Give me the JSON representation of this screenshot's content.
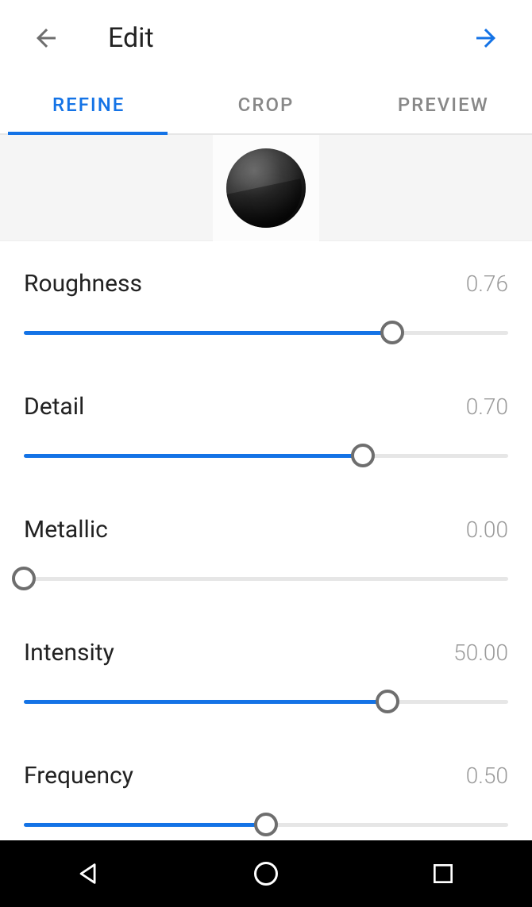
{
  "header": {
    "title": "Edit",
    "back_icon": "arrow-left",
    "forward_icon": "arrow-right"
  },
  "tabs": [
    {
      "label": "REFINE",
      "active": true
    },
    {
      "label": "CROP",
      "active": false
    },
    {
      "label": "PREVIEW",
      "active": false
    }
  ],
  "preview": {
    "material_icon": "sphere-preview"
  },
  "sliders": [
    {
      "name": "roughness",
      "label": "Roughness",
      "value_text": "0.76",
      "fraction": 0.76
    },
    {
      "name": "detail",
      "label": "Detail",
      "value_text": "0.70",
      "fraction": 0.7
    },
    {
      "name": "metallic",
      "label": "Metallic",
      "value_text": "0.00",
      "fraction": 0.0
    },
    {
      "name": "intensity",
      "label": "Intensity",
      "value_text": "50.00",
      "fraction": 0.75
    },
    {
      "name": "frequency",
      "label": "Frequency",
      "value_text": "0.50",
      "fraction": 0.5
    }
  ],
  "system_nav": {
    "back": "triangle-left",
    "home": "circle",
    "recent": "square"
  },
  "colors": {
    "accent": "#1473e6",
    "text": "#222222",
    "muted": "#9a9a9a",
    "track": "#e6e6e6"
  }
}
